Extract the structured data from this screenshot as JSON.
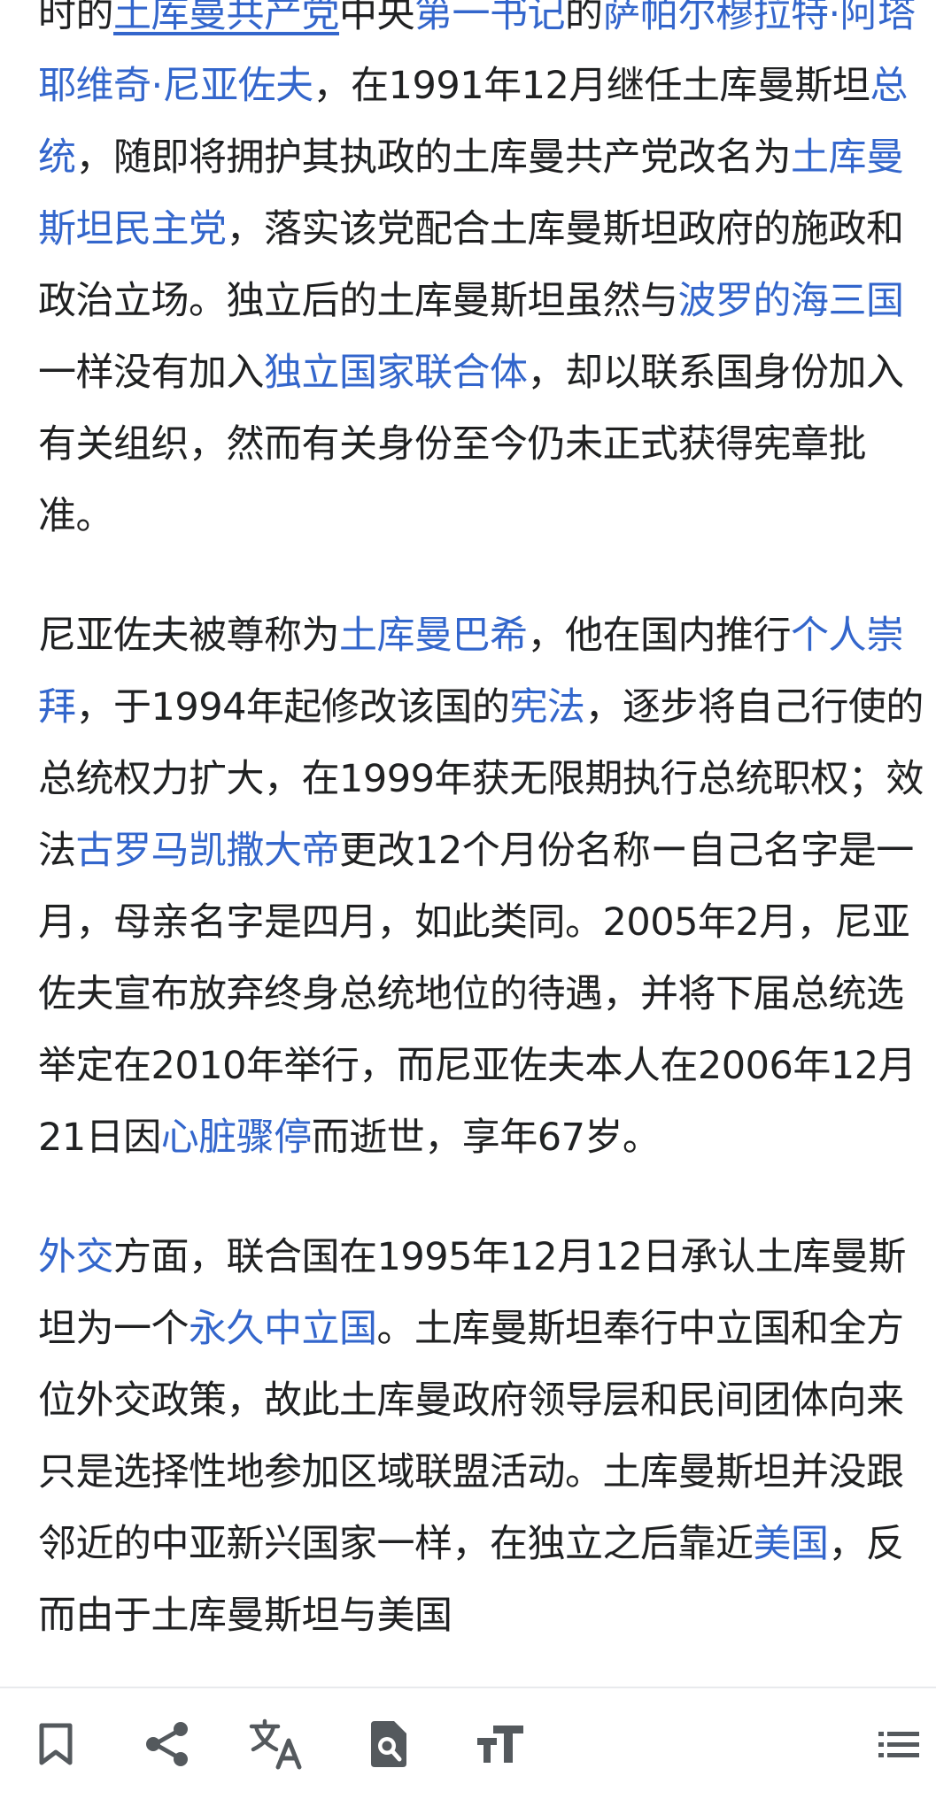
{
  "article": {
    "paragraphs": [
      [
        {
          "text": "时的"
        },
        {
          "text": "土库曼共产党",
          "link": true,
          "underline": true
        },
        {
          "text": "中央"
        },
        {
          "text": "第一书记",
          "link": true
        },
        {
          "text": "的"
        },
        {
          "text": "萨帕尔穆拉特·阿塔耶维奇·尼亚佐夫",
          "link": true
        },
        {
          "text": "，在1991年12月继任土库曼斯坦"
        },
        {
          "text": "总统",
          "link": true
        },
        {
          "text": "，随即将拥护其执政的土库曼共产党改名为"
        },
        {
          "text": "土库曼斯坦民主党",
          "link": true
        },
        {
          "text": "，落实该党配合土库曼斯坦政府的施政和政治立场。独立后的土库曼斯坦虽然与"
        },
        {
          "text": "波罗的海三国",
          "link": true
        },
        {
          "text": "一样没有加入"
        },
        {
          "text": "独立国家联合体",
          "link": true
        },
        {
          "text": "，却以联系国身份加入有关组织，然而有关身份至今仍未正式获得宪章批准。"
        }
      ],
      [
        {
          "text": "尼亚佐夫被尊称为"
        },
        {
          "text": "土库曼巴希",
          "link": true
        },
        {
          "text": "，他在国内推行"
        },
        {
          "text": "个人崇拜",
          "link": true
        },
        {
          "text": "，于1994年起修改该国的"
        },
        {
          "text": "宪法",
          "link": true
        },
        {
          "text": "，逐步将自己行使的总统权力扩大，在1999年获无限期执行总统职权；效法"
        },
        {
          "text": "古罗马凯撒大帝",
          "link": true
        },
        {
          "text": "更改12个月份名称ー自己名字是一月，母亲名字是四月，如此类同。2005年2月，尼亚佐夫宣布放弃终身总统地位的待遇，并将下届总统选举定在2010年举行，而尼亚佐夫本人在2006年12月21日因"
        },
        {
          "text": "心脏骤停",
          "link": true
        },
        {
          "text": "而逝世，享年67岁。"
        }
      ],
      [
        {
          "text": "外交",
          "link": true
        },
        {
          "text": "方面，联合国在1995年12月12日承认土库曼斯坦为一个"
        },
        {
          "text": "永久中立国",
          "link": true
        },
        {
          "text": "。土库曼斯坦奉行中立国和全方位外交政策，故此土库曼政府领导层和民间团体向来只是选择性地参加区域联盟活动。土库曼斯坦并没跟邻近的中亚新兴国家一样，在独立之后靠近"
        },
        {
          "text": "美国",
          "link": true
        },
        {
          "text": "，反而由于土库曼斯坦与美国"
        }
      ]
    ]
  },
  "toolbar": {
    "items": [
      {
        "name": "bookmark-button",
        "icon": "bookmark-icon"
      },
      {
        "name": "share-button",
        "icon": "share-icon"
      },
      {
        "name": "language-button",
        "icon": "translate-icon"
      },
      {
        "name": "find-in-page-button",
        "icon": "find-in-page-icon"
      },
      {
        "name": "text-size-button",
        "icon": "text-size-icon"
      },
      {
        "name": "contents-button",
        "icon": "list-icon"
      }
    ]
  },
  "colors": {
    "link": "#3366cc",
    "text": "#202122",
    "icon": "#54595d"
  }
}
